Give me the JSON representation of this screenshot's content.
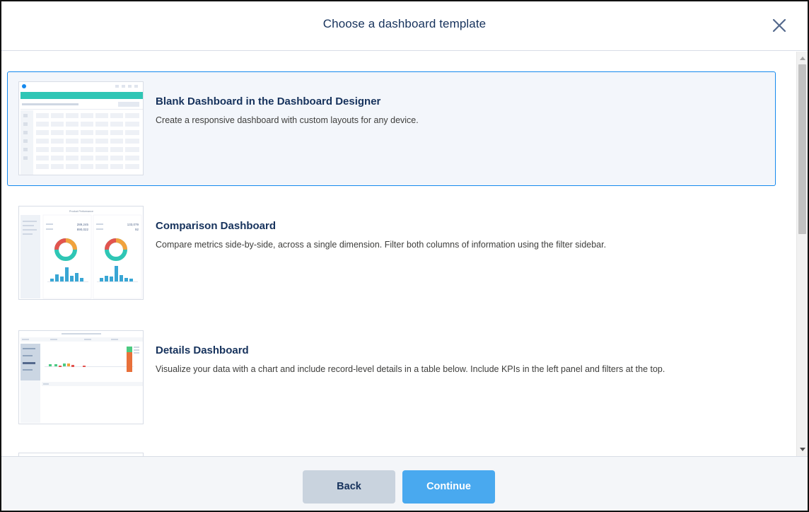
{
  "modal": {
    "title": "Choose a dashboard template",
    "close_icon": "close-icon"
  },
  "templates": [
    {
      "title": "Blank Dashboard in the Dashboard Designer",
      "description": "Create a responsive dashboard with custom layouts for any device.",
      "selected": true
    },
    {
      "title": "Comparison Dashboard",
      "description": "Compare metrics side-by-side, across a single dimension. Filter both columns of information using the filter sidebar.",
      "selected": false,
      "thumbnail_text": {
        "heading": "Product Performance",
        "left_value_1": "289,245",
        "left_value_2": "890,022",
        "right_value_1": "133,079",
        "right_value_2": "92"
      }
    },
    {
      "title": "Details Dashboard",
      "description": "Visualize your data with a chart and include record-level details in a table below. Include KPIs in the left panel and filters at the top.",
      "selected": false
    }
  ],
  "footer": {
    "back_label": "Back",
    "continue_label": "Continue"
  },
  "colors": {
    "selected_border": "#1589ee",
    "selected_bg": "#f3f6fb",
    "continue_bg": "#49a9ef",
    "back_bg": "#c9d3de",
    "teal": "#2fc6b5",
    "bar_blue": "#39a6d4"
  }
}
